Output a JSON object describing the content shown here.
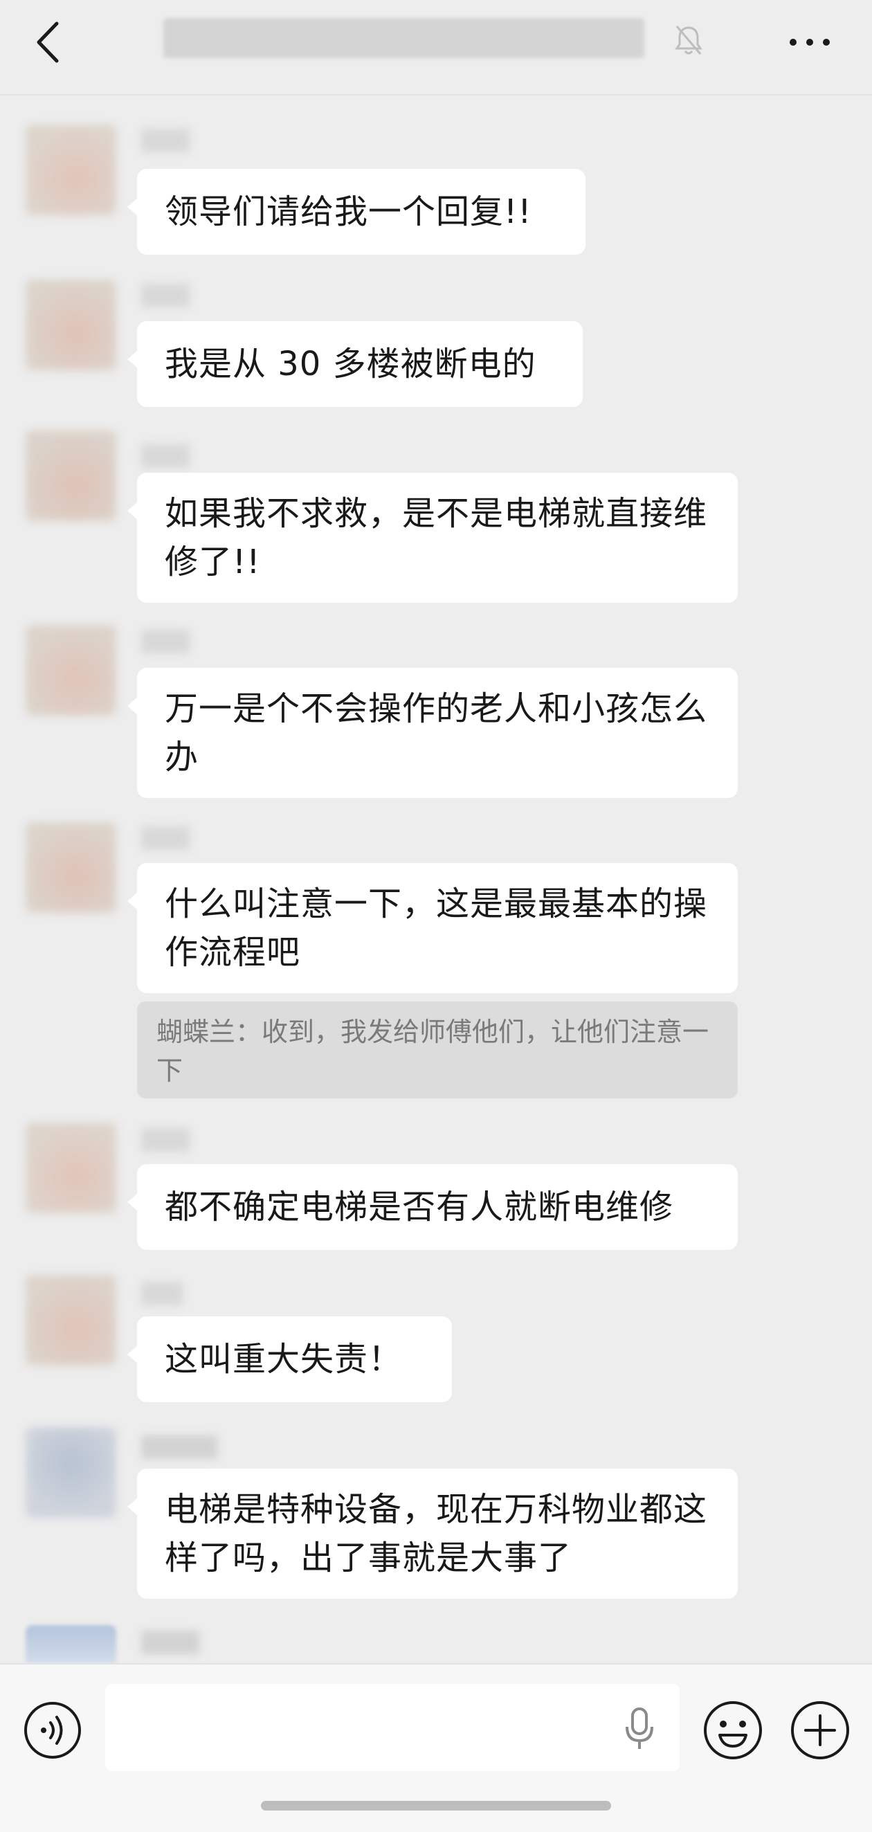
{
  "header": {
    "title": "",
    "back_icon": "back-icon",
    "mute_icon": "bell-muted-icon",
    "more_icon": "more-icon"
  },
  "messages": [
    {
      "text": "领导们请给我一个回复!!"
    },
    {
      "text": "我是从 30 多楼被断电的"
    },
    {
      "text": "如果我不求救，是不是电梯就直接维修了!!"
    },
    {
      "text": "万一是个不会操作的老人和小孩怎么办"
    },
    {
      "text": "什么叫注意一下，这是最最基本的操作流程吧",
      "quote": "蝴蝶兰：收到，我发给师傅他们，让他们注意一下"
    },
    {
      "text": "都不确定电梯是否有人就断电维修"
    },
    {
      "text": "这叫重大失责！"
    },
    {
      "text": "电梯是特种设备，现在万科物业都这样了吗，出了事就是大事了"
    }
  ],
  "input_bar": {
    "placeholder": "",
    "voice_icon": "voice-input-icon",
    "mic_icon": "microphone-icon",
    "emoji_icon": "emoji-icon",
    "plus_icon": "plus-icon"
  }
}
